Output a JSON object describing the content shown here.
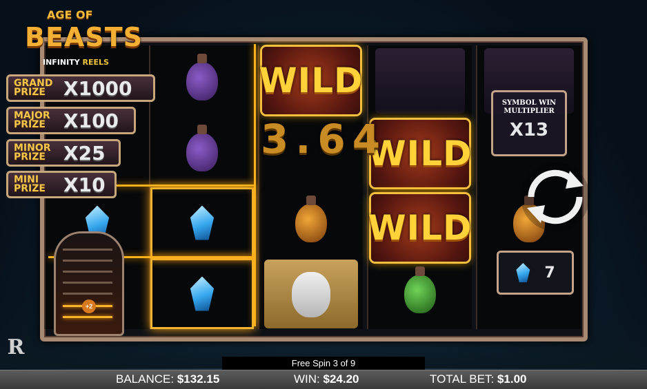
{
  "logo": {
    "line1": "AGE OF",
    "line2": "BEASTS",
    "line3a": "INFINITY",
    "line3b": "REELS"
  },
  "prizes": [
    {
      "name1": "GRAND",
      "name2": "PRIZE",
      "value": "X1000"
    },
    {
      "name1": "MAJOR",
      "name2": "PRIZE",
      "value": "X100"
    },
    {
      "name1": "MINOR",
      "name2": "PRIZE",
      "value": "X25"
    },
    {
      "name1": "MINI",
      "name2": "PRIZE",
      "value": "X10"
    }
  ],
  "reels": {
    "wild_label": "WILD",
    "win_amount": "3.64"
  },
  "ladder": {
    "badge": "+2"
  },
  "multiplier": {
    "label1": "SYMBOL WIN",
    "label2": "MULTIPLIER",
    "value": "X13"
  },
  "gem_counter": {
    "value": "7"
  },
  "provider_logo": "R",
  "free_spin": "Free Spin 3 of 9",
  "status_bar": {
    "balance_label": "BALANCE:",
    "balance_value": "$132.15",
    "win_label": "WIN:",
    "win_value": "$24.20",
    "bet_label": "TOTAL BET:",
    "bet_value": "$1.00"
  }
}
